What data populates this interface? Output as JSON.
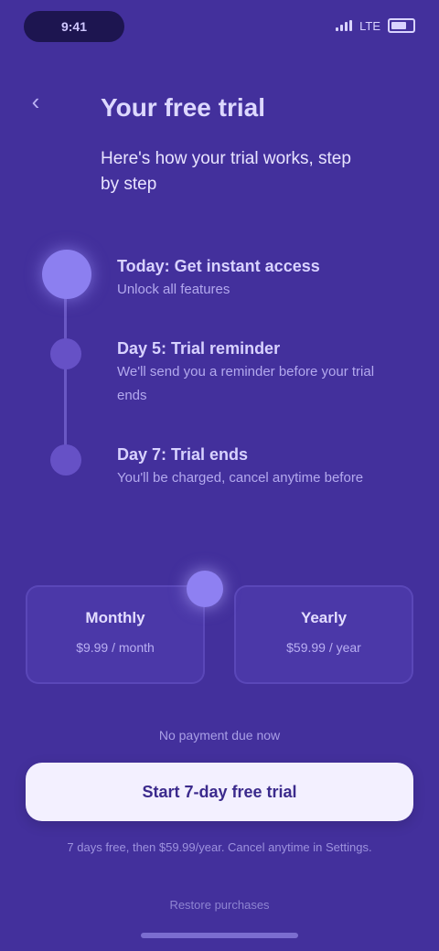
{
  "status_bar": {
    "time": "9:41",
    "signal": "LTE"
  },
  "header": {
    "back_icon": "chevron-left-icon"
  },
  "title": "Your free trial",
  "subtitle": "Here's how your trial works, step by step",
  "timeline": [
    {
      "title": "Today: Get instant access",
      "desc": "Unlock all features"
    },
    {
      "title": "Day 5: Trial reminder",
      "desc": "We'll send you a reminder before your trial ends"
    },
    {
      "title": "Day 7: Trial ends",
      "desc": "You'll be charged, cancel anytime before"
    }
  ],
  "plans": [
    {
      "name": "Monthly",
      "price": "$9.99 / month"
    },
    {
      "name": "Yearly",
      "price": "$59.99 / year"
    }
  ],
  "trial_note": "No payment due now",
  "cta_label": "Start 7-day free trial",
  "legal": "7 days free, then $59.99/year. Cancel anytime in Settings.",
  "restore_label": "Restore purchases",
  "colors": {
    "background": "#43309c",
    "accent": "#8c7ff0",
    "button": "#f3f0ff"
  }
}
